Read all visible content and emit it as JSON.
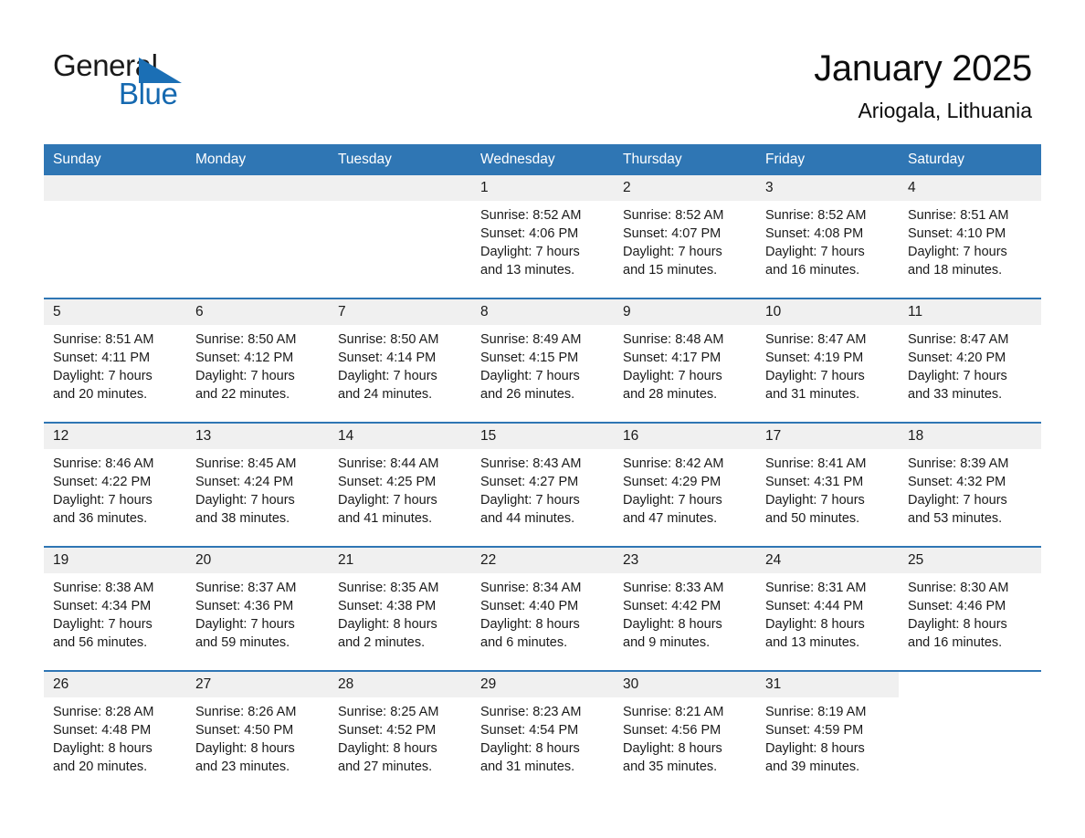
{
  "brand": {
    "name_part1": "General",
    "name_part2": "Blue",
    "triangle_icon": "triangle-icon",
    "accent_color": "#1b6fb5"
  },
  "header": {
    "title": "January 2025",
    "subtitle": "Ariogala, Lithuania"
  },
  "calendar": {
    "header_bg": "#2f76b4",
    "daynum_bg": "#f0f0f0",
    "weekday_headers": [
      "Sunday",
      "Monday",
      "Tuesday",
      "Wednesday",
      "Thursday",
      "Friday",
      "Saturday"
    ],
    "weeks": [
      [
        {
          "day": "",
          "lines": []
        },
        {
          "day": "",
          "lines": []
        },
        {
          "day": "",
          "lines": []
        },
        {
          "day": "1",
          "lines": [
            "Sunrise: 8:52 AM",
            "Sunset: 4:06 PM",
            "Daylight: 7 hours",
            "and 13 minutes."
          ]
        },
        {
          "day": "2",
          "lines": [
            "Sunrise: 8:52 AM",
            "Sunset: 4:07 PM",
            "Daylight: 7 hours",
            "and 15 minutes."
          ]
        },
        {
          "day": "3",
          "lines": [
            "Sunrise: 8:52 AM",
            "Sunset: 4:08 PM",
            "Daylight: 7 hours",
            "and 16 minutes."
          ]
        },
        {
          "day": "4",
          "lines": [
            "Sunrise: 8:51 AM",
            "Sunset: 4:10 PM",
            "Daylight: 7 hours",
            "and 18 minutes."
          ]
        }
      ],
      [
        {
          "day": "5",
          "lines": [
            "Sunrise: 8:51 AM",
            "Sunset: 4:11 PM",
            "Daylight: 7 hours",
            "and 20 minutes."
          ]
        },
        {
          "day": "6",
          "lines": [
            "Sunrise: 8:50 AM",
            "Sunset: 4:12 PM",
            "Daylight: 7 hours",
            "and 22 minutes."
          ]
        },
        {
          "day": "7",
          "lines": [
            "Sunrise: 8:50 AM",
            "Sunset: 4:14 PM",
            "Daylight: 7 hours",
            "and 24 minutes."
          ]
        },
        {
          "day": "8",
          "lines": [
            "Sunrise: 8:49 AM",
            "Sunset: 4:15 PM",
            "Daylight: 7 hours",
            "and 26 minutes."
          ]
        },
        {
          "day": "9",
          "lines": [
            "Sunrise: 8:48 AM",
            "Sunset: 4:17 PM",
            "Daylight: 7 hours",
            "and 28 minutes."
          ]
        },
        {
          "day": "10",
          "lines": [
            "Sunrise: 8:47 AM",
            "Sunset: 4:19 PM",
            "Daylight: 7 hours",
            "and 31 minutes."
          ]
        },
        {
          "day": "11",
          "lines": [
            "Sunrise: 8:47 AM",
            "Sunset: 4:20 PM",
            "Daylight: 7 hours",
            "and 33 minutes."
          ]
        }
      ],
      [
        {
          "day": "12",
          "lines": [
            "Sunrise: 8:46 AM",
            "Sunset: 4:22 PM",
            "Daylight: 7 hours",
            "and 36 minutes."
          ]
        },
        {
          "day": "13",
          "lines": [
            "Sunrise: 8:45 AM",
            "Sunset: 4:24 PM",
            "Daylight: 7 hours",
            "and 38 minutes."
          ]
        },
        {
          "day": "14",
          "lines": [
            "Sunrise: 8:44 AM",
            "Sunset: 4:25 PM",
            "Daylight: 7 hours",
            "and 41 minutes."
          ]
        },
        {
          "day": "15",
          "lines": [
            "Sunrise: 8:43 AM",
            "Sunset: 4:27 PM",
            "Daylight: 7 hours",
            "and 44 minutes."
          ]
        },
        {
          "day": "16",
          "lines": [
            "Sunrise: 8:42 AM",
            "Sunset: 4:29 PM",
            "Daylight: 7 hours",
            "and 47 minutes."
          ]
        },
        {
          "day": "17",
          "lines": [
            "Sunrise: 8:41 AM",
            "Sunset: 4:31 PM",
            "Daylight: 7 hours",
            "and 50 minutes."
          ]
        },
        {
          "day": "18",
          "lines": [
            "Sunrise: 8:39 AM",
            "Sunset: 4:32 PM",
            "Daylight: 7 hours",
            "and 53 minutes."
          ]
        }
      ],
      [
        {
          "day": "19",
          "lines": [
            "Sunrise: 8:38 AM",
            "Sunset: 4:34 PM",
            "Daylight: 7 hours",
            "and 56 minutes."
          ]
        },
        {
          "day": "20",
          "lines": [
            "Sunrise: 8:37 AM",
            "Sunset: 4:36 PM",
            "Daylight: 7 hours",
            "and 59 minutes."
          ]
        },
        {
          "day": "21",
          "lines": [
            "Sunrise: 8:35 AM",
            "Sunset: 4:38 PM",
            "Daylight: 8 hours",
            "and 2 minutes."
          ]
        },
        {
          "day": "22",
          "lines": [
            "Sunrise: 8:34 AM",
            "Sunset: 4:40 PM",
            "Daylight: 8 hours",
            "and 6 minutes."
          ]
        },
        {
          "day": "23",
          "lines": [
            "Sunrise: 8:33 AM",
            "Sunset: 4:42 PM",
            "Daylight: 8 hours",
            "and 9 minutes."
          ]
        },
        {
          "day": "24",
          "lines": [
            "Sunrise: 8:31 AM",
            "Sunset: 4:44 PM",
            "Daylight: 8 hours",
            "and 13 minutes."
          ]
        },
        {
          "day": "25",
          "lines": [
            "Sunrise: 8:30 AM",
            "Sunset: 4:46 PM",
            "Daylight: 8 hours",
            "and 16 minutes."
          ]
        }
      ],
      [
        {
          "day": "26",
          "lines": [
            "Sunrise: 8:28 AM",
            "Sunset: 4:48 PM",
            "Daylight: 8 hours",
            "and 20 minutes."
          ]
        },
        {
          "day": "27",
          "lines": [
            "Sunrise: 8:26 AM",
            "Sunset: 4:50 PM",
            "Daylight: 8 hours",
            "and 23 minutes."
          ]
        },
        {
          "day": "28",
          "lines": [
            "Sunrise: 8:25 AM",
            "Sunset: 4:52 PM",
            "Daylight: 8 hours",
            "and 27 minutes."
          ]
        },
        {
          "day": "29",
          "lines": [
            "Sunrise: 8:23 AM",
            "Sunset: 4:54 PM",
            "Daylight: 8 hours",
            "and 31 minutes."
          ]
        },
        {
          "day": "30",
          "lines": [
            "Sunrise: 8:21 AM",
            "Sunset: 4:56 PM",
            "Daylight: 8 hours",
            "and 35 minutes."
          ]
        },
        {
          "day": "31",
          "lines": [
            "Sunrise: 8:19 AM",
            "Sunset: 4:59 PM",
            "Daylight: 8 hours",
            "and 39 minutes."
          ]
        },
        {
          "day": "",
          "lines": []
        }
      ]
    ]
  }
}
